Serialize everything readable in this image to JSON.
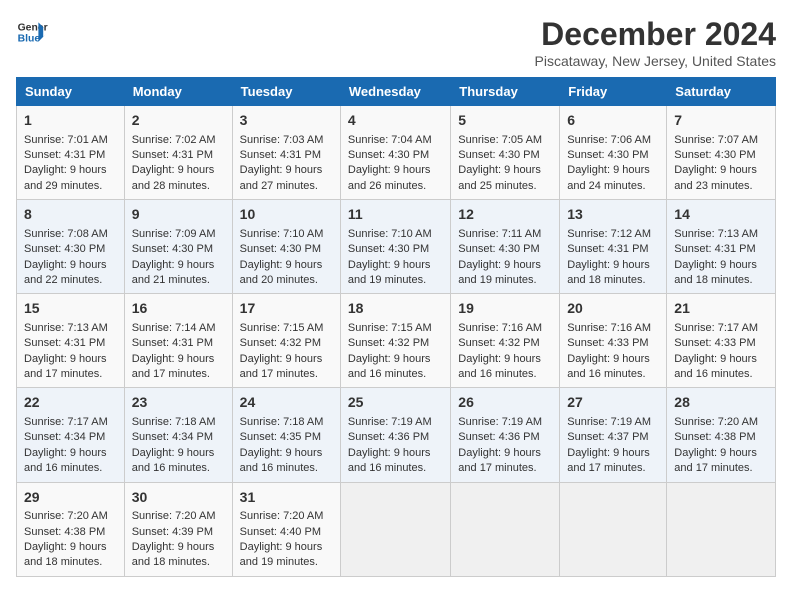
{
  "logo": {
    "line1": "General",
    "line2": "Blue"
  },
  "title": "December 2024",
  "location": "Piscataway, New Jersey, United States",
  "days_of_week": [
    "Sunday",
    "Monday",
    "Tuesday",
    "Wednesday",
    "Thursday",
    "Friday",
    "Saturday"
  ],
  "weeks": [
    [
      {
        "day": 1,
        "rise": "7:01 AM",
        "set": "4:31 PM",
        "daylight": "9 hours and 29 minutes."
      },
      {
        "day": 2,
        "rise": "7:02 AM",
        "set": "4:31 PM",
        "daylight": "9 hours and 28 minutes."
      },
      {
        "day": 3,
        "rise": "7:03 AM",
        "set": "4:31 PM",
        "daylight": "9 hours and 27 minutes."
      },
      {
        "day": 4,
        "rise": "7:04 AM",
        "set": "4:30 PM",
        "daylight": "9 hours and 26 minutes."
      },
      {
        "day": 5,
        "rise": "7:05 AM",
        "set": "4:30 PM",
        "daylight": "9 hours and 25 minutes."
      },
      {
        "day": 6,
        "rise": "7:06 AM",
        "set": "4:30 PM",
        "daylight": "9 hours and 24 minutes."
      },
      {
        "day": 7,
        "rise": "7:07 AM",
        "set": "4:30 PM",
        "daylight": "9 hours and 23 minutes."
      }
    ],
    [
      {
        "day": 8,
        "rise": "7:08 AM",
        "set": "4:30 PM",
        "daylight": "9 hours and 22 minutes."
      },
      {
        "day": 9,
        "rise": "7:09 AM",
        "set": "4:30 PM",
        "daylight": "9 hours and 21 minutes."
      },
      {
        "day": 10,
        "rise": "7:10 AM",
        "set": "4:30 PM",
        "daylight": "9 hours and 20 minutes."
      },
      {
        "day": 11,
        "rise": "7:10 AM",
        "set": "4:30 PM",
        "daylight": "9 hours and 19 minutes."
      },
      {
        "day": 12,
        "rise": "7:11 AM",
        "set": "4:30 PM",
        "daylight": "9 hours and 19 minutes."
      },
      {
        "day": 13,
        "rise": "7:12 AM",
        "set": "4:31 PM",
        "daylight": "9 hours and 18 minutes."
      },
      {
        "day": 14,
        "rise": "7:13 AM",
        "set": "4:31 PM",
        "daylight": "9 hours and 18 minutes."
      }
    ],
    [
      {
        "day": 15,
        "rise": "7:13 AM",
        "set": "4:31 PM",
        "daylight": "9 hours and 17 minutes."
      },
      {
        "day": 16,
        "rise": "7:14 AM",
        "set": "4:31 PM",
        "daylight": "9 hours and 17 minutes."
      },
      {
        "day": 17,
        "rise": "7:15 AM",
        "set": "4:32 PM",
        "daylight": "9 hours and 17 minutes."
      },
      {
        "day": 18,
        "rise": "7:15 AM",
        "set": "4:32 PM",
        "daylight": "9 hours and 16 minutes."
      },
      {
        "day": 19,
        "rise": "7:16 AM",
        "set": "4:32 PM",
        "daylight": "9 hours and 16 minutes."
      },
      {
        "day": 20,
        "rise": "7:16 AM",
        "set": "4:33 PM",
        "daylight": "9 hours and 16 minutes."
      },
      {
        "day": 21,
        "rise": "7:17 AM",
        "set": "4:33 PM",
        "daylight": "9 hours and 16 minutes."
      }
    ],
    [
      {
        "day": 22,
        "rise": "7:17 AM",
        "set": "4:34 PM",
        "daylight": "9 hours and 16 minutes."
      },
      {
        "day": 23,
        "rise": "7:18 AM",
        "set": "4:34 PM",
        "daylight": "9 hours and 16 minutes."
      },
      {
        "day": 24,
        "rise": "7:18 AM",
        "set": "4:35 PM",
        "daylight": "9 hours and 16 minutes."
      },
      {
        "day": 25,
        "rise": "7:19 AM",
        "set": "4:36 PM",
        "daylight": "9 hours and 16 minutes."
      },
      {
        "day": 26,
        "rise": "7:19 AM",
        "set": "4:36 PM",
        "daylight": "9 hours and 17 minutes."
      },
      {
        "day": 27,
        "rise": "7:19 AM",
        "set": "4:37 PM",
        "daylight": "9 hours and 17 minutes."
      },
      {
        "day": 28,
        "rise": "7:20 AM",
        "set": "4:38 PM",
        "daylight": "9 hours and 17 minutes."
      }
    ],
    [
      {
        "day": 29,
        "rise": "7:20 AM",
        "set": "4:38 PM",
        "daylight": "9 hours and 18 minutes."
      },
      {
        "day": 30,
        "rise": "7:20 AM",
        "set": "4:39 PM",
        "daylight": "9 hours and 18 minutes."
      },
      {
        "day": 31,
        "rise": "7:20 AM",
        "set": "4:40 PM",
        "daylight": "9 hours and 19 minutes."
      },
      null,
      null,
      null,
      null
    ]
  ],
  "labels": {
    "sunrise": "Sunrise:",
    "sunset": "Sunset:",
    "daylight": "Daylight:"
  }
}
